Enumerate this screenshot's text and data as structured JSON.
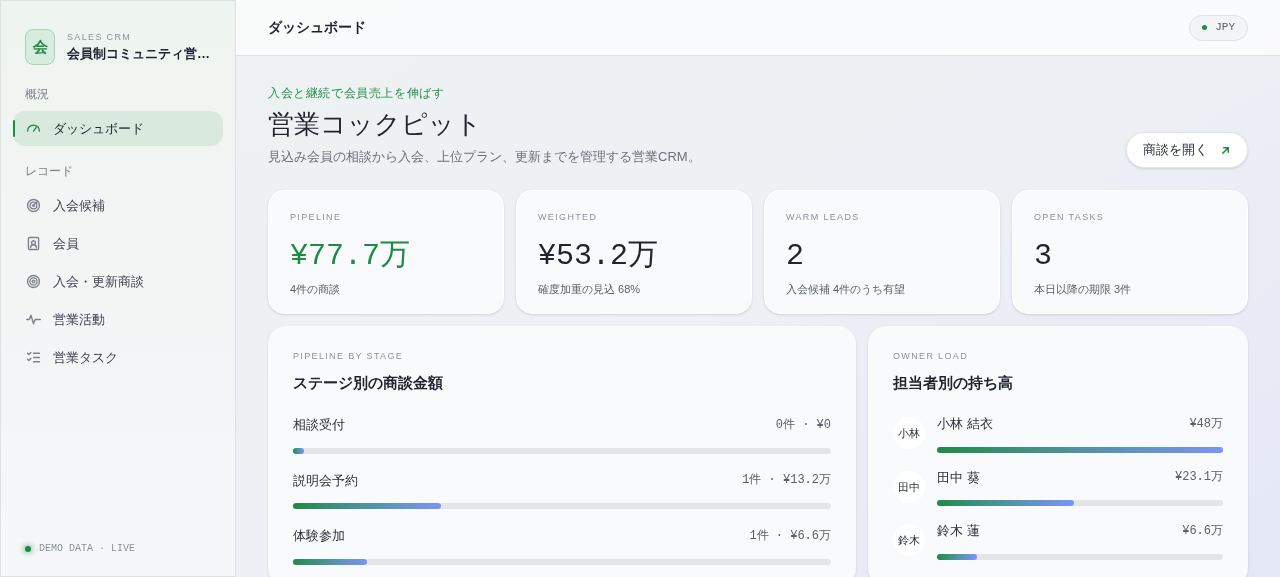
{
  "sidebar": {
    "brand": {
      "mark": "会",
      "eyebrow": "SALES CRM",
      "title": "会員制コミュニティ営…"
    },
    "sections": [
      {
        "label": "概況",
        "items": [
          {
            "label": "ダッシュボード",
            "selected": true
          }
        ]
      },
      {
        "label": "レコード",
        "items": [
          {
            "label": "入会候補",
            "selected": false
          },
          {
            "label": "会員",
            "selected": false
          },
          {
            "label": "入会・更新商談",
            "selected": false
          },
          {
            "label": "営業活動",
            "selected": false
          },
          {
            "label": "営業タスク",
            "selected": false
          }
        ]
      }
    ],
    "footer": "DEMO DATA · LIVE"
  },
  "header": {
    "title": "ダッシュボード",
    "currency": "JPY"
  },
  "hero": {
    "eyebrow": "入会と継続で会員売上を伸ばす",
    "title": "営業コックピット",
    "subtitle": "見込み会員の相談から入会、上位プラン、更新までを管理する営業CRM。",
    "button": "商談を開く"
  },
  "kpis": [
    {
      "label": "PIPELINE",
      "value": "¥77.7万",
      "note": "4件の商談",
      "accent": true
    },
    {
      "label": "WEIGHTED",
      "value": "¥53.2万",
      "note": "確度加重の見込 68%",
      "accent": false
    },
    {
      "label": "WARM LEADS",
      "value": "2",
      "note": "入会候補 4件のうち有望",
      "accent": false
    },
    {
      "label": "OPEN TASKS",
      "value": "3",
      "note": "本日以降の期限 3件",
      "accent": false
    }
  ],
  "stages": {
    "eyebrow": "PIPELINE BY STAGE",
    "title": "ステージ別の商談金額",
    "rows": [
      {
        "label": "相談受付",
        "reading": "0件 · ¥0",
        "level": 0.02
      },
      {
        "label": "説明会予約",
        "reading": "1件 · ¥13.2万",
        "level": 0.275
      },
      {
        "label": "体験参加",
        "reading": "1件 · ¥6.6万",
        "level": 0.137
      }
    ]
  },
  "owners": {
    "eyebrow": "OWNER LOAD",
    "title": "担当者別の持ち高",
    "rows": [
      {
        "initials": "小林",
        "name": "小林 結衣",
        "reading": "¥48万",
        "level": 1.0
      },
      {
        "initials": "田中",
        "name": "田中 葵",
        "reading": "¥23.1万",
        "level": 0.48
      },
      {
        "initials": "鈴木",
        "name": "鈴木 蓮",
        "reading": "¥6.6万",
        "level": 0.14
      }
    ]
  }
}
